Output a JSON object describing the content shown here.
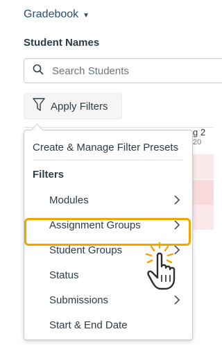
{
  "header": {
    "gradebook_label": "Gradebook",
    "caret_icon": "caret-down-icon"
  },
  "students": {
    "section_title": "Student Names",
    "search_placeholder": "Search Students"
  },
  "filters": {
    "apply_label": "Apply Filters",
    "icon": "filter-funnel-icon"
  },
  "background_grid": {
    "column_header": "g 2",
    "column_sub": "20"
  },
  "dropdown": {
    "presets_label": "Create & Manage Filter Presets",
    "heading": "Filters",
    "items": [
      {
        "label": "Modules",
        "has_submenu": true
      },
      {
        "label": "Assignment Groups",
        "has_submenu": true
      },
      {
        "label": "Student Groups",
        "has_submenu": true,
        "highlighted": true
      },
      {
        "label": "Status",
        "has_submenu": false
      },
      {
        "label": "Submissions",
        "has_submenu": true
      },
      {
        "label": "Start & End Date",
        "has_submenu": false
      }
    ]
  },
  "colors": {
    "highlight": "#f0a500",
    "link": "#2b4e6e",
    "row_tint": "#fbe9e9"
  }
}
